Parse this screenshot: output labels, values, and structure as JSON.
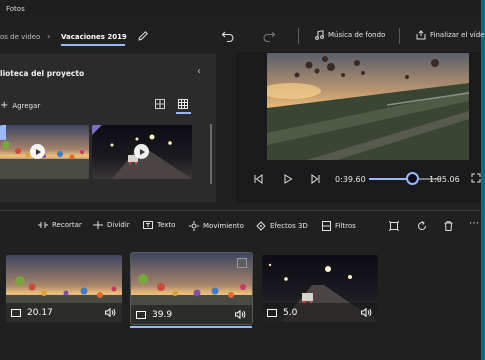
{
  "window": {
    "title": "Fotos"
  },
  "toolbar": {
    "breadcrumb_parent": "os de video",
    "breadcrumb_current": "Vacaciones 2019",
    "music_label": "Música de fondo",
    "finish_label": "Finalizar el vídeo"
  },
  "library": {
    "title": "lioteca del proyecto",
    "add_label": "Agregar",
    "items": [
      {
        "name": "balloons"
      },
      {
        "name": "night-street"
      }
    ]
  },
  "player": {
    "current_time": "0:39.60",
    "total_time": "1:05.06",
    "progress": 0.6
  },
  "storyboard": {
    "tools": [
      {
        "name": "recortar",
        "label": "Recortar"
      },
      {
        "name": "dividir",
        "label": "Dividir"
      },
      {
        "name": "texto",
        "label": "Texto"
      },
      {
        "name": "movimiento",
        "label": "Movimiento"
      },
      {
        "name": "efectos-3d",
        "label": "Efectos 3D"
      },
      {
        "name": "filtros",
        "label": "Filtros"
      }
    ],
    "clips": [
      {
        "duration": "20.17"
      },
      {
        "duration": "39.9",
        "selected": true
      },
      {
        "duration": "5.0"
      }
    ]
  },
  "colors": {
    "accent": "#9ab8ff",
    "background": "#202020",
    "panel": "#2b2b2b"
  }
}
